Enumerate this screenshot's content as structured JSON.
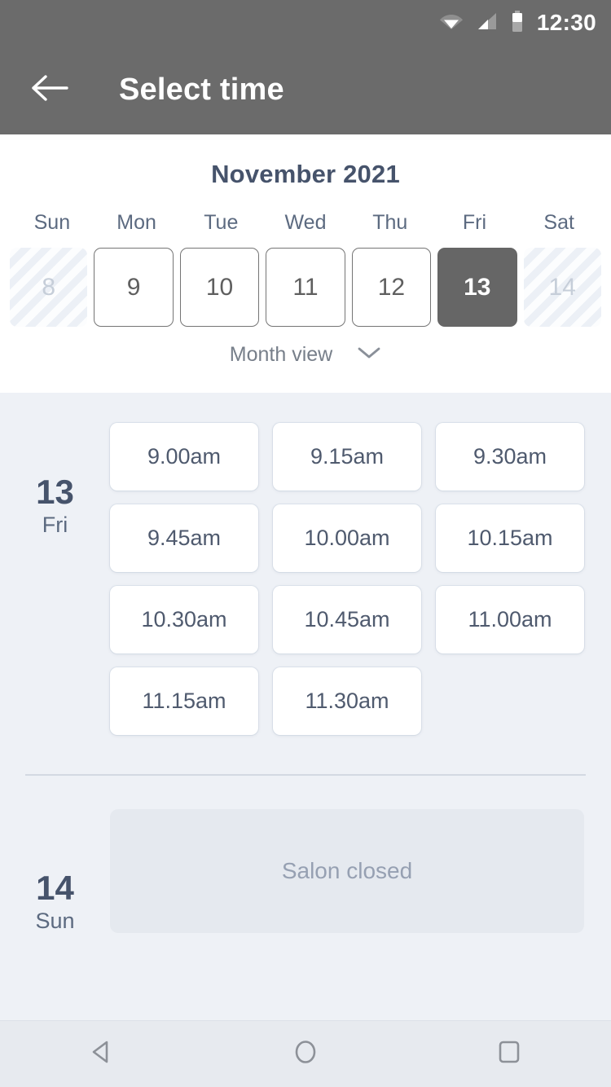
{
  "status_bar": {
    "time": "12:30",
    "icons": [
      "wifi-icon",
      "signal-icon",
      "battery-icon"
    ]
  },
  "app_bar": {
    "back_icon": "arrow-left-icon",
    "title": "Select time"
  },
  "calendar": {
    "month_title": "November 2021",
    "weekdays": [
      "Sun",
      "Mon",
      "Tue",
      "Wed",
      "Thu",
      "Fri",
      "Sat"
    ],
    "days": [
      {
        "num": "8",
        "state": "disabled"
      },
      {
        "num": "9",
        "state": "available"
      },
      {
        "num": "10",
        "state": "available"
      },
      {
        "num": "11",
        "state": "available"
      },
      {
        "num": "12",
        "state": "available"
      },
      {
        "num": "13",
        "state": "selected"
      },
      {
        "num": "14",
        "state": "disabled"
      }
    ],
    "view_toggle": {
      "label": "Month view",
      "icon": "chevron-down-icon"
    }
  },
  "schedule": [
    {
      "day_number": "13",
      "day_of_week": "Fri",
      "slots": [
        "9.00am",
        "9.15am",
        "9.30am",
        "9.45am",
        "10.00am",
        "10.15am",
        "10.30am",
        "10.45am",
        "11.00am",
        "11.15am",
        "11.30am"
      ]
    },
    {
      "day_number": "14",
      "day_of_week": "Sun",
      "closed_message": "Salon closed"
    }
  ],
  "nav_bar": {
    "back": "nav-back-icon",
    "home": "nav-home-icon",
    "recents": "nav-recents-icon"
  },
  "colors": {
    "app_bar": "#6b6b6b",
    "body": "#eef1f6",
    "accent_text": "#46536b",
    "selected_day": "#666666",
    "card": "#ffffff",
    "closed_card": "#e5e9ef"
  }
}
